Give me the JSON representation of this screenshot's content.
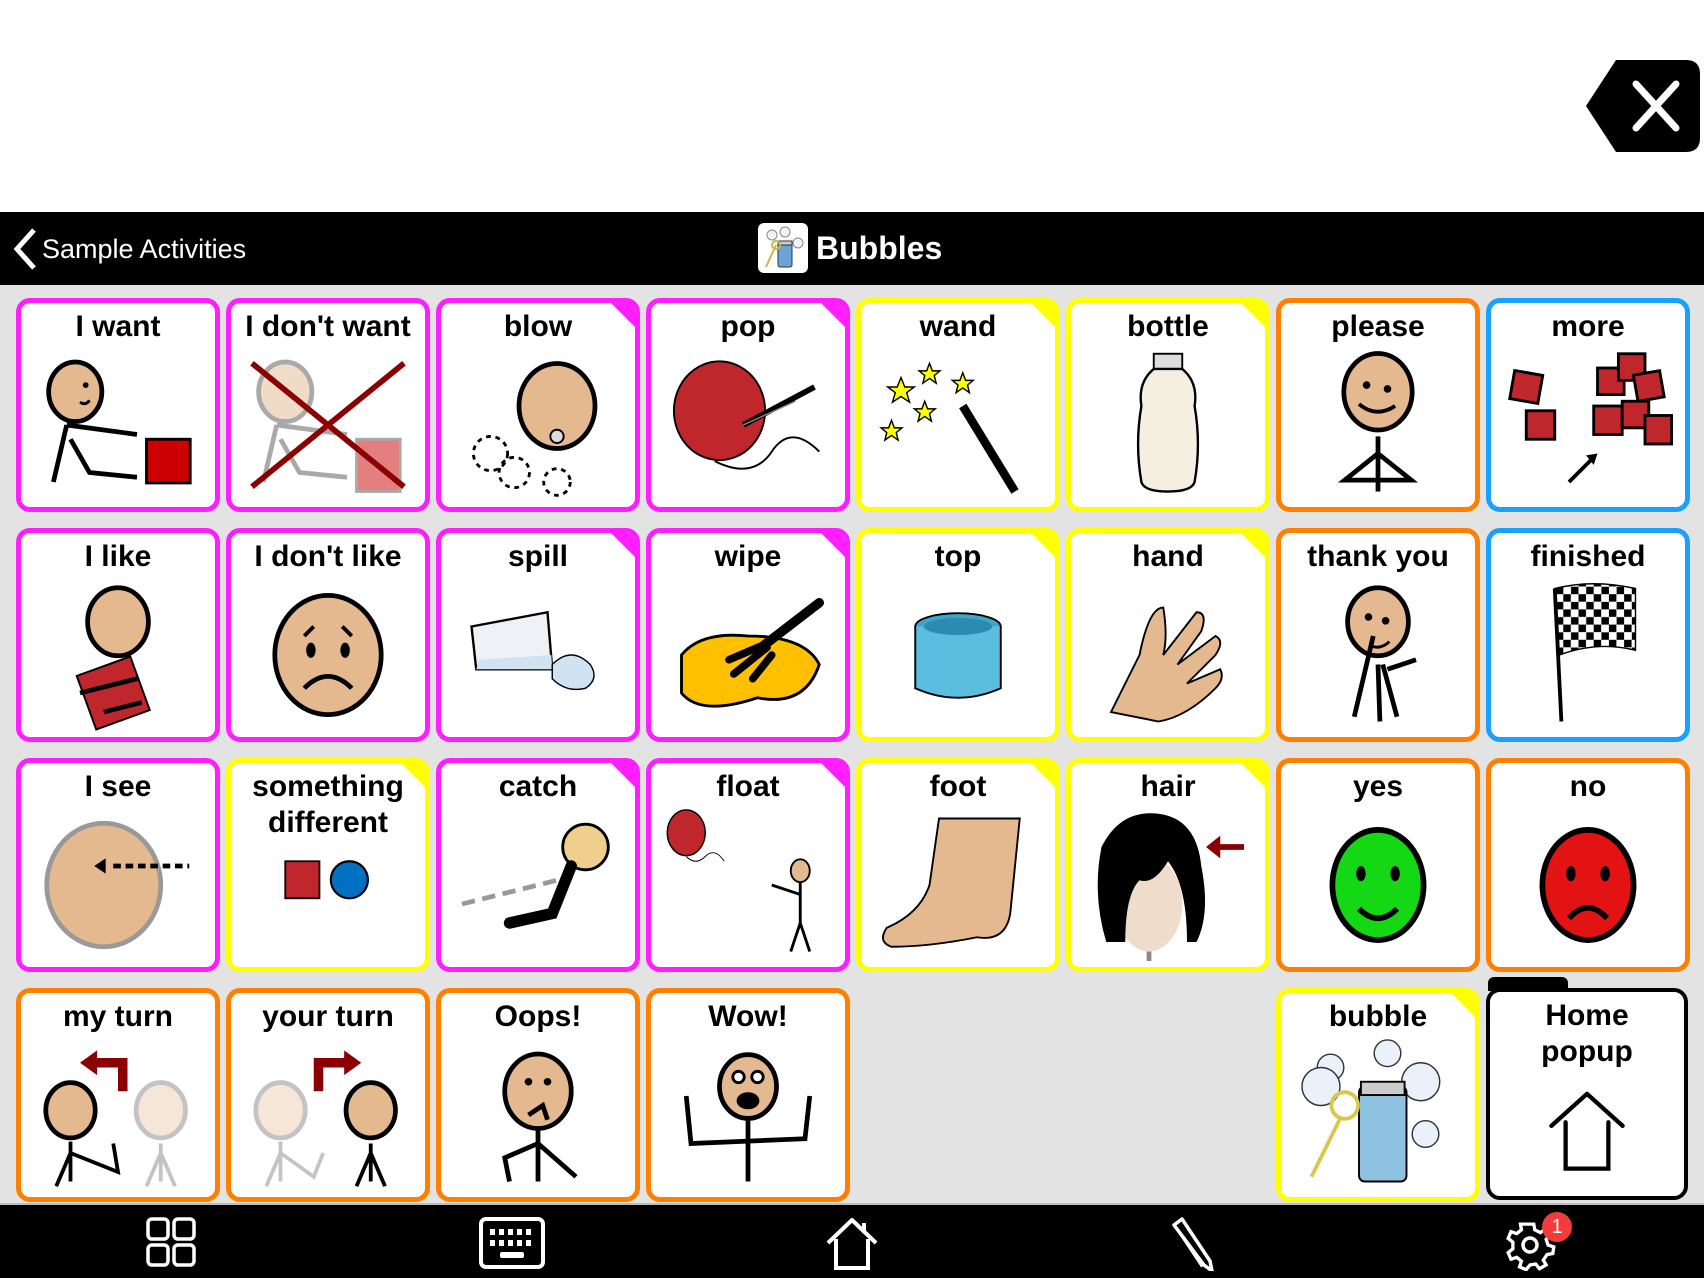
{
  "app": {
    "back_label": "Sample Activities",
    "title": "Bubbles",
    "title_icon": "bubbles-board-icon"
  },
  "message_bar": {
    "text": "",
    "clear_icon": "backspace-clear-icon"
  },
  "colors": {
    "social_magenta": "#ff1eff",
    "noun_yellow": "#ffff00",
    "social_orange": "#ff8000",
    "core_blue": "#1aa0ff",
    "folder_black": "#000000",
    "grid_background": "#e3e3e3",
    "badge_red": "#f23c3c"
  },
  "cells": [
    {
      "label": "I want",
      "icon": "person-reaching-block-icon",
      "color": "#ff1eff",
      "fold": false
    },
    {
      "label": "I don't want",
      "icon": "person-reaching-crossed-icon",
      "color": "#ff1eff",
      "fold": false
    },
    {
      "label": "blow",
      "icon": "face-blowing-icon",
      "color": "#ff1eff",
      "fold": true
    },
    {
      "label": "pop",
      "icon": "balloon-pin-icon",
      "color": "#ff1eff",
      "fold": true
    },
    {
      "label": "wand",
      "icon": "magic-wand-icon",
      "color": "#ffff00",
      "fold": true
    },
    {
      "label": "bottle",
      "icon": "bottle-icon",
      "color": "#ffff00",
      "fold": true
    },
    {
      "label": "please",
      "icon": "person-please-icon",
      "color": "#ff8000",
      "fold": false
    },
    {
      "label": "more",
      "icon": "many-blocks-icon",
      "color": "#1aa0ff",
      "fold": false
    },
    {
      "label": "I like",
      "icon": "person-hugging-book-icon",
      "color": "#ff1eff",
      "fold": false
    },
    {
      "label": "I don't like",
      "icon": "sad-face-icon",
      "color": "#ff1eff",
      "fold": false
    },
    {
      "label": "spill",
      "icon": "spilled-cup-icon",
      "color": "#ff1eff",
      "fold": true
    },
    {
      "label": "wipe",
      "icon": "hand-wiping-icon",
      "color": "#ff1eff",
      "fold": true
    },
    {
      "label": "top",
      "icon": "bottle-cap-icon",
      "color": "#ffff00",
      "fold": true
    },
    {
      "label": "hand",
      "icon": "hand-icon",
      "color": "#ffff00",
      "fold": true
    },
    {
      "label": "thank you",
      "icon": "person-thank-you-icon",
      "color": "#ff8000",
      "fold": false
    },
    {
      "label": "finished",
      "icon": "checkered-flag-icon",
      "color": "#1aa0ff",
      "fold": false
    },
    {
      "label": "I see",
      "icon": "eye-looking-icon",
      "color": "#ff1eff",
      "fold": false
    },
    {
      "label": "something different",
      "icon": "square-circle-icon",
      "color": "#ffff00",
      "fold": true
    },
    {
      "label": "catch",
      "icon": "hand-catching-icon",
      "color": "#ff1eff",
      "fold": true
    },
    {
      "label": "float",
      "icon": "floating-balloon-icon",
      "color": "#ff1eff",
      "fold": true
    },
    {
      "label": "foot",
      "icon": "foot-icon",
      "color": "#ffff00",
      "fold": true
    },
    {
      "label": "hair",
      "icon": "hair-icon",
      "color": "#ffff00",
      "fold": true
    },
    {
      "label": "yes",
      "icon": "green-smiley-icon",
      "color": "#ff8000",
      "fold": false
    },
    {
      "label": "no",
      "icon": "red-frowny-icon",
      "color": "#ff8000",
      "fold": false
    },
    {
      "label": "my turn",
      "icon": "my-turn-icon",
      "color": "#ff8000",
      "fold": false
    },
    {
      "label": "your turn",
      "icon": "your-turn-icon",
      "color": "#ff8000",
      "fold": false
    },
    {
      "label": "Oops!",
      "icon": "oops-icon",
      "color": "#ff8000",
      "fold": false
    },
    {
      "label": "Wow!",
      "icon": "wow-icon",
      "color": "#ff8000",
      "fold": false
    },
    null,
    null,
    {
      "label": "bubble",
      "icon": "bubble-bottle-icon",
      "color": "#ffff00",
      "fold": true
    },
    {
      "label": "Home popup",
      "icon": "home-outline-icon",
      "color": "#000000",
      "fold": false,
      "folder": true
    }
  ],
  "bottom_bar": {
    "items": [
      {
        "name": "grid-view",
        "icon": "grid-icon"
      },
      {
        "name": "keyboard",
        "icon": "keyboard-icon"
      },
      {
        "name": "home",
        "icon": "home-icon"
      },
      {
        "name": "edit",
        "icon": "pencil-icon"
      },
      {
        "name": "settings",
        "icon": "gear-icon"
      }
    ],
    "settings_badge": "1"
  }
}
